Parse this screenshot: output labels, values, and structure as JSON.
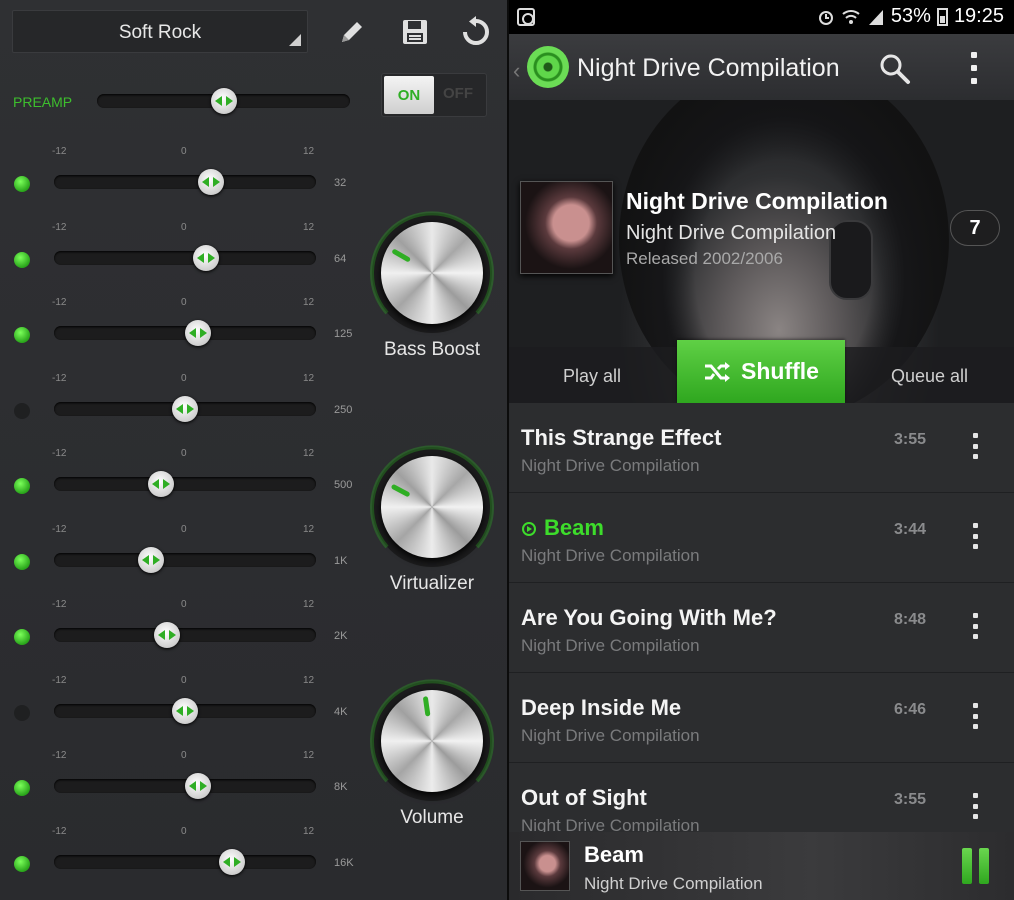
{
  "equalizer": {
    "preset": "Soft Rock",
    "preamp_label": "PREAMP",
    "preamp_level": 0.5,
    "toggle": {
      "on_label": "ON",
      "off_label": "OFF",
      "state": "on"
    },
    "scale": {
      "min": "-12",
      "mid": "0",
      "max": "12"
    },
    "bands": [
      {
        "freq": "32",
        "enabled": true,
        "level": 0.6
      },
      {
        "freq": "64",
        "enabled": true,
        "level": 0.58
      },
      {
        "freq": "125",
        "enabled": true,
        "level": 0.55
      },
      {
        "freq": "250",
        "enabled": false,
        "level": 0.5
      },
      {
        "freq": "500",
        "enabled": true,
        "level": 0.41
      },
      {
        "freq": "1K",
        "enabled": true,
        "level": 0.37
      },
      {
        "freq": "2K",
        "enabled": true,
        "level": 0.43
      },
      {
        "freq": "4K",
        "enabled": false,
        "level": 0.5
      },
      {
        "freq": "8K",
        "enabled": true,
        "level": 0.55
      },
      {
        "freq": "16K",
        "enabled": true,
        "level": 0.68
      }
    ],
    "knobs": [
      {
        "label": "Bass Boost",
        "angle": -60
      },
      {
        "label": "Virtualizer",
        "angle": -62
      },
      {
        "label": "Volume",
        "angle": -8
      }
    ],
    "colors": {
      "accent": "#2fae24",
      "led_on": "#4fd43a"
    }
  },
  "status_bar": {
    "battery": "53%",
    "time": "19:25"
  },
  "app_bar": {
    "title": "Night Drive Compilation"
  },
  "album": {
    "title": "Night Drive Compilation",
    "artist": "Night Drive Compilation",
    "released": "Released 2002/2006",
    "track_count": "7",
    "play_all": "Play all",
    "shuffle": "Shuffle",
    "queue_all": "Queue all"
  },
  "tracks": [
    {
      "title": "This Strange Effect",
      "sub": "Night Drive Compilation",
      "duration": "3:55",
      "playing": false
    },
    {
      "title": "Beam",
      "sub": "Night Drive Compilation",
      "duration": "3:44",
      "playing": true
    },
    {
      "title": "Are You Going With Me?",
      "sub": "Night Drive Compilation",
      "duration": "8:48",
      "playing": false
    },
    {
      "title": "Deep Inside Me",
      "sub": "Night Drive Compilation",
      "duration": "6:46",
      "playing": false
    },
    {
      "title": "Out of Sight",
      "sub": "Night Drive Compilation",
      "duration": "3:55",
      "playing": false
    }
  ],
  "now_playing": {
    "title": "Beam",
    "sub": "Night Drive Compilation"
  }
}
